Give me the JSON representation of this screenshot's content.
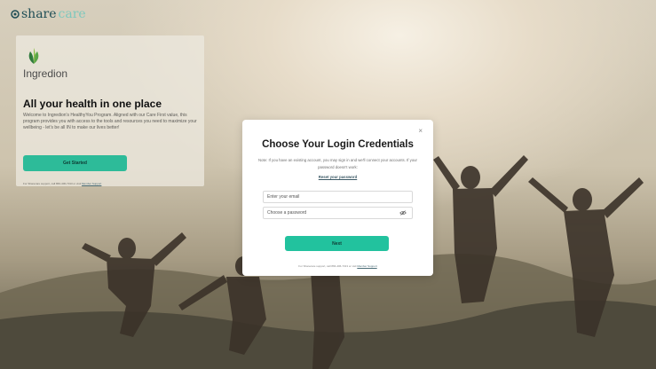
{
  "brand": {
    "share": "share",
    "care": "care"
  },
  "left_panel": {
    "company": "Ingredion",
    "title": "All your health in one place",
    "body": "Welcome to Ingredion's HealthyYou Program. Aligned with our Care First value, this program provides you with access to the tools and resources you need to maximize your wellbeing - let's be all IN to make our lives better!",
    "cta_label": "Get Started",
    "footer_text": "For Sharecare support, call 866-406-7313 or visit ",
    "footer_link": "Member Support"
  },
  "modal": {
    "close": "×",
    "title": "Choose Your Login Credentials",
    "note": "Note: If you have an existing account, you may sign in and we'll connect your accounts. If your password doesn't work:",
    "reset_link": "Reset your password",
    "email_placeholder": "Enter your email",
    "password_placeholder": "Choose a password",
    "next_label": "Next",
    "footer_text": "For Sharecare support, call 866-406-7313 or visit ",
    "footer_link": "Member Support"
  },
  "colors": {
    "accent": "#22c29e",
    "brand_dark": "#1f4e56",
    "brand_light": "#7ec8bd"
  },
  "icons": {
    "password_toggle": "eye-slash-icon",
    "close": "close-icon"
  }
}
